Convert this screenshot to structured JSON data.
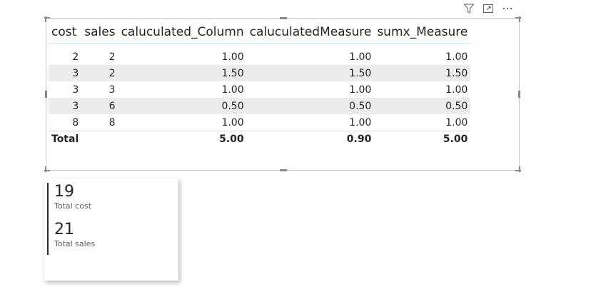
{
  "table": {
    "columns": [
      "cost",
      "sales",
      "caluculated_Column",
      "caluculatedMeasure",
      "sumx_Measure"
    ],
    "rows": [
      [
        "2",
        "2",
        "1.00",
        "1.00",
        "1.00"
      ],
      [
        "3",
        "2",
        "1.50",
        "1.50",
        "1.50"
      ],
      [
        "3",
        "3",
        "1.00",
        "1.00",
        "1.00"
      ],
      [
        "3",
        "6",
        "0.50",
        "0.50",
        "0.50"
      ],
      [
        "8",
        "8",
        "1.00",
        "1.00",
        "1.00"
      ]
    ],
    "total": {
      "label": "Total",
      "caluculated_Column": "5.00",
      "caluculatedMeasure": "0.90",
      "sumx_Measure": "5.00"
    }
  },
  "card": {
    "items": [
      {
        "value": "19",
        "label": "Total cost"
      },
      {
        "value": "21",
        "label": "Total sales"
      }
    ]
  },
  "header_icons": [
    "filter-icon",
    "focus-mode-icon",
    "more-options-icon"
  ],
  "colors": {
    "row_alt": "#ececec",
    "header_rule": "#c9e3f0",
    "text": "#252423",
    "border": "#c8c6c4"
  }
}
